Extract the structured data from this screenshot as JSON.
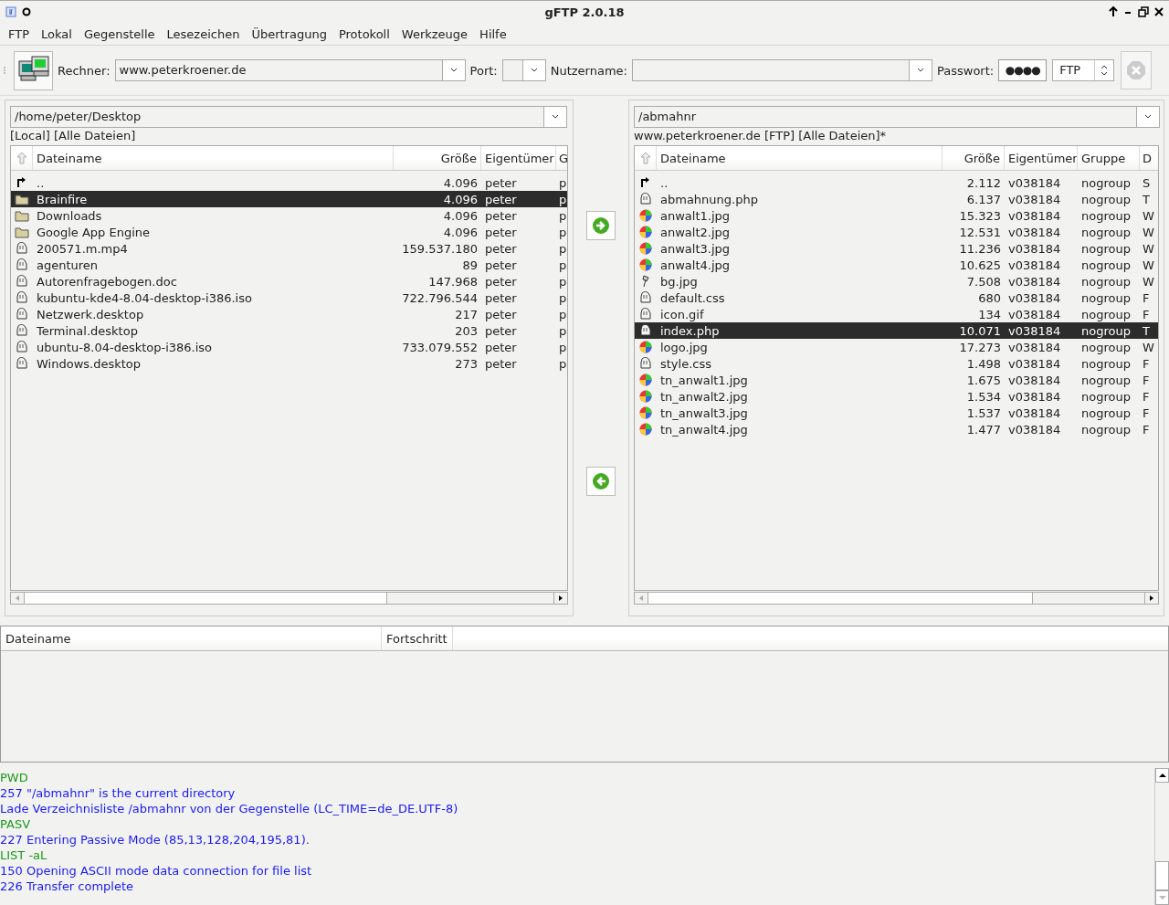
{
  "window": {
    "title": "gFTP 2.0.18"
  },
  "menu": [
    {
      "label": "FTP"
    },
    {
      "label": "Lokal"
    },
    {
      "label": "Gegenstelle"
    },
    {
      "label": "Lesezeichen"
    },
    {
      "label": "Übertragung"
    },
    {
      "label": "Protokoll"
    },
    {
      "label": "Werkzeuge"
    },
    {
      "label": "Hilfe"
    }
  ],
  "toolbar": {
    "host_label": "Rechner:",
    "host": "www.peterkroener.de",
    "port_label": "Port:",
    "user_label": "Nutzername:",
    "password_label": "Passwort:",
    "password": "●●●●",
    "protocol": "FTP",
    "stop_disabled": true
  },
  "panels": [
    {
      "path": "/home/peter/Desktop",
      "info": "[Local] [Alle Dateien]",
      "columns": [
        "Dateiname",
        "Größe",
        "Eigentümer",
        "G"
      ],
      "rows": [
        {
          "kind": "up",
          "cells": [
            "..",
            "4.096",
            "peter",
            "p"
          ],
          "selected": false
        },
        {
          "kind": "folder",
          "cells": [
            "Brainfire",
            "4.096",
            "peter",
            "p"
          ],
          "selected": true
        },
        {
          "kind": "folder",
          "cells": [
            "Downloads",
            "4.096",
            "peter",
            "p"
          ],
          "selected": false
        },
        {
          "kind": "folder",
          "cells": [
            "Google App Engine",
            "4.096",
            "peter",
            "p"
          ],
          "selected": false
        },
        {
          "kind": "file",
          "cells": [
            "200571.m.mp4",
            "159.537.180",
            "peter",
            "p"
          ],
          "selected": false
        },
        {
          "kind": "file",
          "cells": [
            "agenturen",
            "89",
            "peter",
            "p"
          ],
          "selected": false
        },
        {
          "kind": "file",
          "cells": [
            "Autorenfragebogen.doc",
            "147.968",
            "peter",
            "p"
          ],
          "selected": false
        },
        {
          "kind": "file",
          "cells": [
            "kubuntu-kde4-8.04-desktop-i386.iso",
            "722.796.544",
            "peter",
            "p"
          ],
          "selected": false
        },
        {
          "kind": "file",
          "cells": [
            "Netzwerk.desktop",
            "217",
            "peter",
            "p"
          ],
          "selected": false
        },
        {
          "kind": "file",
          "cells": [
            "Terminal.desktop",
            "203",
            "peter",
            "p"
          ],
          "selected": false
        },
        {
          "kind": "file",
          "cells": [
            "ubuntu-8.04-desktop-i386.iso",
            "733.079.552",
            "peter",
            "p"
          ],
          "selected": false
        },
        {
          "kind": "file",
          "cells": [
            "Windows.desktop",
            "273",
            "peter",
            "p"
          ],
          "selected": false
        }
      ]
    },
    {
      "path": "/abmahnr",
      "info": "www.peterkroener.de [FTP] [Alle Dateien]*",
      "columns": [
        "Dateiname",
        "Größe",
        "Eigentümer",
        "Gruppe",
        "D"
      ],
      "rows": [
        {
          "kind": "up",
          "cells": [
            "..",
            "2.112",
            "v038184",
            "nogroup",
            "S"
          ],
          "selected": false
        },
        {
          "kind": "file",
          "cells": [
            "abmahnung.php",
            "6.137",
            "v038184",
            "nogroup",
            "T"
          ],
          "selected": false
        },
        {
          "kind": "image",
          "cells": [
            "anwalt1.jpg",
            "15.323",
            "v038184",
            "nogroup",
            "W"
          ],
          "selected": false
        },
        {
          "kind": "image",
          "cells": [
            "anwalt2.jpg",
            "12.531",
            "v038184",
            "nogroup",
            "W"
          ],
          "selected": false
        },
        {
          "kind": "image",
          "cells": [
            "anwalt3.jpg",
            "11.236",
            "v038184",
            "nogroup",
            "W"
          ],
          "selected": false
        },
        {
          "kind": "image",
          "cells": [
            "anwalt4.jpg",
            "10.625",
            "v038184",
            "nogroup",
            "W"
          ],
          "selected": false
        },
        {
          "kind": "brush",
          "cells": [
            "bg.jpg",
            "7.508",
            "v038184",
            "nogroup",
            "W"
          ],
          "selected": false
        },
        {
          "kind": "file",
          "cells": [
            "default.css",
            "680",
            "v038184",
            "nogroup",
            "F"
          ],
          "selected": false
        },
        {
          "kind": "file",
          "cells": [
            "icon.gif",
            "134",
            "v038184",
            "nogroup",
            "F"
          ],
          "selected": false
        },
        {
          "kind": "file",
          "cells": [
            "index.php",
            "10.071",
            "v038184",
            "nogroup",
            "T"
          ],
          "selected": true
        },
        {
          "kind": "image",
          "cells": [
            "logo.jpg",
            "17.273",
            "v038184",
            "nogroup",
            "W"
          ],
          "selected": false
        },
        {
          "kind": "file",
          "cells": [
            "style.css",
            "1.498",
            "v038184",
            "nogroup",
            "F"
          ],
          "selected": false
        },
        {
          "kind": "image",
          "cells": [
            "tn_anwalt1.jpg",
            "1.675",
            "v038184",
            "nogroup",
            "F"
          ],
          "selected": false
        },
        {
          "kind": "image",
          "cells": [
            "tn_anwalt2.jpg",
            "1.534",
            "v038184",
            "nogroup",
            "F"
          ],
          "selected": false
        },
        {
          "kind": "image",
          "cells": [
            "tn_anwalt3.jpg",
            "1.537",
            "v038184",
            "nogroup",
            "F"
          ],
          "selected": false
        },
        {
          "kind": "image",
          "cells": [
            "tn_anwalt4.jpg",
            "1.477",
            "v038184",
            "nogroup",
            "F"
          ],
          "selected": false
        }
      ]
    }
  ],
  "transfers": {
    "columns": [
      "Dateiname",
      "Fortschritt"
    ]
  },
  "log": [
    {
      "kind": "command",
      "text": "PWD"
    },
    {
      "kind": "response",
      "text": "257 \"/abmahnr\" is the current directory"
    },
    {
      "kind": "response",
      "text": "Lade Verzeichnisliste /abmahnr von der Gegenstelle (LC_TIME=de_DE.UTF-8)"
    },
    {
      "kind": "command",
      "text": "PASV"
    },
    {
      "kind": "response",
      "text": "227 Entering Passive Mode (85,13,128,204,195,81)."
    },
    {
      "kind": "command",
      "text": "LIST -aL"
    },
    {
      "kind": "response",
      "text": "150 Opening ASCII mode data connection for file list"
    },
    {
      "kind": "response",
      "text": "226 Transfer complete"
    }
  ]
}
